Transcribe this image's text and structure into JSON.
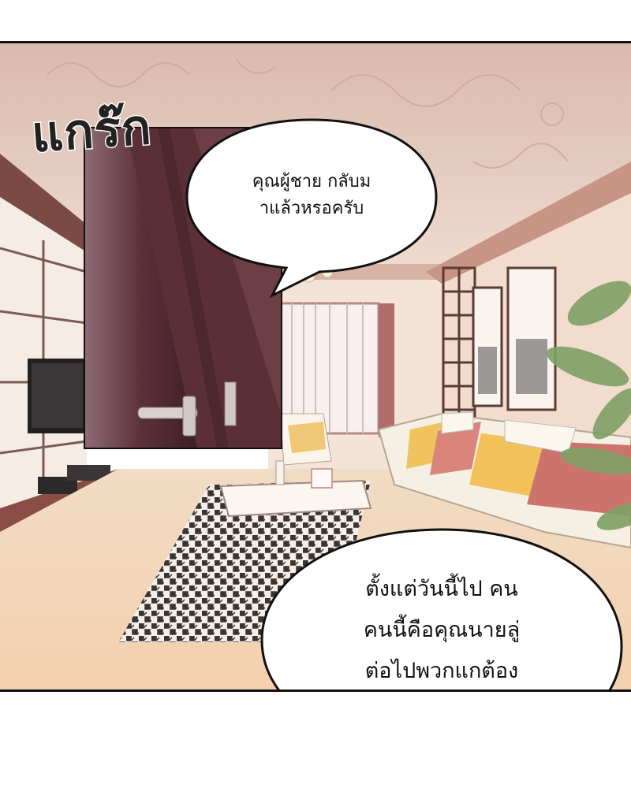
{
  "sound_effect": "แกร๊ก",
  "speech_bubbles": [
    {
      "text": "คุณผู้ชาย กลับม\nาแล้วหรอครับ"
    },
    {
      "text": "ตั้งแต่วันนี้ไป คน\nคนนี้คือคุณนายลู่\nต่อไปพวกแกต้อง\nเรียกเขาว่าคุณนาย"
    }
  ],
  "colors": {
    "wall": "#eed9cc",
    "floor": "#f0d5b8",
    "door": "#5a2f36",
    "sofa": "#f3ece2"
  }
}
